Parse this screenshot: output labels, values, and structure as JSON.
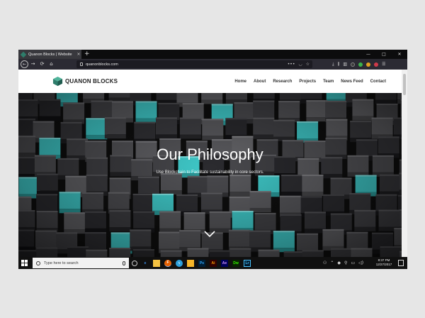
{
  "browser": {
    "tab_title": "Quanon Blocks | Website",
    "tab_close": "×",
    "new_tab": "+",
    "controls": {
      "minimize": "—",
      "maximize": "□",
      "close": "✕"
    },
    "nav": {
      "back": "←",
      "forward": "→",
      "refresh": "⟳",
      "home": "⌂"
    },
    "url": "quanonblocks.com",
    "url_tools": {
      "more": "•••",
      "pocket": "◡",
      "bookmark": "☆"
    },
    "toolbar_icons": {
      "download": "⤓",
      "library": "⫼",
      "sidebar": "▥",
      "menu": "☰"
    }
  },
  "site": {
    "logo_text": "QUANON BLOCKS",
    "menu": [
      "Home",
      "About",
      "Research",
      "Projects",
      "Team",
      "News Feed",
      "Contact"
    ],
    "hero_title": "Our Philosophy",
    "hero_subtitle": "Use Blockchain to Facilitate sustainability in core sectors."
  },
  "taskbar": {
    "search_placeholder": "Type here to search",
    "apps": [
      "e",
      "F",
      "ᛃ",
      "Ps",
      "Ai",
      "Ae",
      "Dw",
      "Lr"
    ],
    "time": "8:37 PM",
    "date": "12/27/2017"
  },
  "colors": {
    "accent_teal": "#3fc8c8",
    "logo_green": "#2e7d6b"
  }
}
